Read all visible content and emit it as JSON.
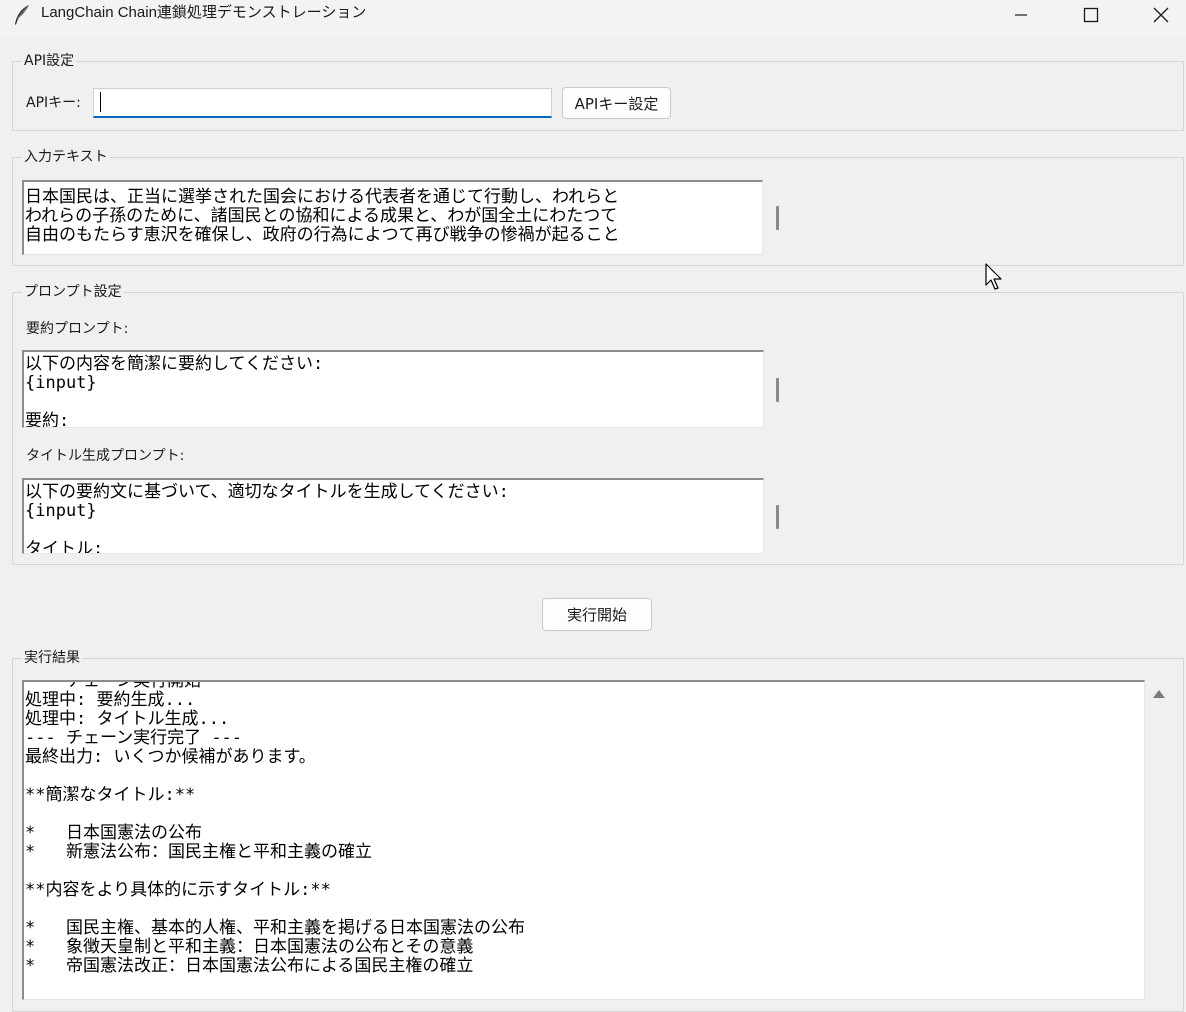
{
  "window": {
    "title": "LangChain Chain連鎖処理デモンストレーション"
  },
  "api": {
    "group_label": "API設定",
    "key_label": "APIキー:",
    "key_value": "",
    "set_button": "APIキー設定"
  },
  "input": {
    "group_label": "入力テキスト",
    "lines": [
      "日本国民は、正当に選挙された国会における代表者を通じて行動し、われらと",
      "われらの子孫のために、諸国民との協和による成果と、わが国全土にわたつて",
      "自由のもたらす恵沢を確保し、政府の行為によつて再び戦争の惨禍が起ること"
    ]
  },
  "prompts": {
    "group_label": "プロンプト設定",
    "summary_label": "要約プロンプト:",
    "summary_lines": [
      "以下の内容を簡潔に要約してください:",
      "{input}",
      "",
      "要約:"
    ],
    "title_label": "タイトル生成プロンプト:",
    "title_lines": [
      "以下の要約文に基づいて、適切なタイトルを生成してください:",
      "{input}",
      "",
      "タイトル:"
    ]
  },
  "run_button": "実行開始",
  "results": {
    "group_label": "実行結果",
    "lines": [
      "--- チェーン実行開始 ---",
      "処理中: 要約生成...",
      "処理中: タイトル生成...",
      "--- チェーン実行完了 ---",
      "最終出力: いくつか候補があります。",
      "",
      "**簡潔なタイトル:**",
      "",
      "*   日本国憲法の公布",
      "*   新憲法公布：国民主権と平和主義の確立",
      "",
      "**内容をより具体的に示すタイトル:**",
      "",
      "*   国民主権、基本的人権、平和主義を掲げる日本国憲法の公布",
      "*   象徴天皇制と平和主義：日本国憲法の公布とその意義",
      "*   帝国憲法改正：日本国憲法公布による国民主権の確立"
    ]
  },
  "icons": {
    "app": "feather-icon",
    "minimize": "minimize-icon",
    "maximize": "maximize-icon",
    "close": "close-icon",
    "scroll_up": "triangle-up-icon",
    "cursor": "mouse-pointer-icon"
  }
}
